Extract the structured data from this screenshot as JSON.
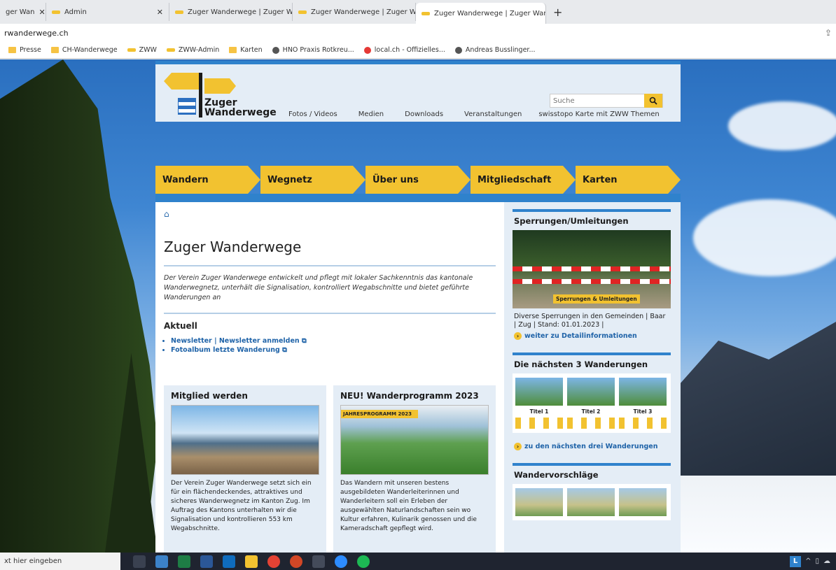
{
  "browser": {
    "tabs": [
      {
        "label": "ger Wan"
      },
      {
        "label": "Admin"
      },
      {
        "label": "Zuger Wanderwege | Zuger Wan"
      },
      {
        "label": "Zuger Wanderwege | Zuger Wan"
      },
      {
        "label": "Zuger Wanderwege | Zuger Wan"
      }
    ],
    "new_tab": "+",
    "url": "rwanderwege.ch",
    "bookmarks": [
      "Presse",
      "CH-Wanderwege",
      "ZWW",
      "ZWW-Admin",
      "Karten",
      "HNO Praxis Rotkreu...",
      "local.ch - Offizielles...",
      "Andreas Busslinger..."
    ]
  },
  "site": {
    "logo_text_1": "Zuger",
    "logo_text_2": "Wanderwege",
    "top_nav": [
      "Fotos / Videos",
      "Medien",
      "Downloads",
      "Veranstaltungen",
      "swisstopo Karte mit ZWW Themen"
    ],
    "search_placeholder": "Suche",
    "main_nav": [
      "Wandern",
      "Wegnetz",
      "Über uns",
      "Mitgliedschaft",
      "Karten"
    ],
    "page_title": "Zuger Wanderwege",
    "intro": "Der Verein Zuger Wanderwege entwickelt und pflegt mit lokaler Sachkenntnis das kantonale Wanderwegnetz, unterhält die Signalisation, kontrolliert Wegabschnitte und bietet geführte Wanderungen an",
    "aktuell_title": "Aktuell",
    "aktuell_links": {
      "newsletter": "Newsletter",
      "sep": "|",
      "newsletter_signup": "Newsletter anmelden",
      "album": "Fotoalbum letzte Wanderung"
    },
    "cards": [
      {
        "title": "Mitglied werden",
        "text": "Der Verein Zuger Wanderwege setzt sich ein für ein flächendeckendes, attraktives und sicheres Wanderwegnetz im Kanton Zug. Im Auftrag des Kantons unterhalten wir die Signalisation und kontrollieren 553 km Wegabschnitte."
      },
      {
        "title": "NEU! Wanderprogramm 2023",
        "banner": "JAHRESPROGRAMM 2023",
        "text": "Das Wandern mit unseren bestens ausgebildeten Wanderleiterinnen und Wanderleitern soll ein Erleben der ausgewählten Naturlandschaften sein wo Kultur erfahren, Kulinarik genossen und die Kameradschaft gepflegt wird."
      }
    ],
    "sidebar": {
      "sperrungen_title": "Sperrungen/Umleitungen",
      "sperrungen_tag": "Sperrungen & Umleitungen",
      "sperrungen_text": "Diverse Sperrungen in den Gemeinden | Baar | Zug | Stand: 01.01.2023 |",
      "sperrungen_more": "weiter zu Detailinformationen",
      "next_title": "Die nächsten 3 Wanderungen",
      "next_items": [
        "Titel 1",
        "Titel 2",
        "Titel 3"
      ],
      "next_more": "zu den nächsten drei Wanderungen",
      "vorschlaege_title": "Wandervorschläge"
    }
  },
  "taskbar": {
    "search_text": "xt hier eingeben",
    "tray_letter": "L"
  },
  "colors": {
    "accent_yellow": "#f2c230",
    "accent_blue": "#2f82cc",
    "panel": "#e4edf6"
  }
}
